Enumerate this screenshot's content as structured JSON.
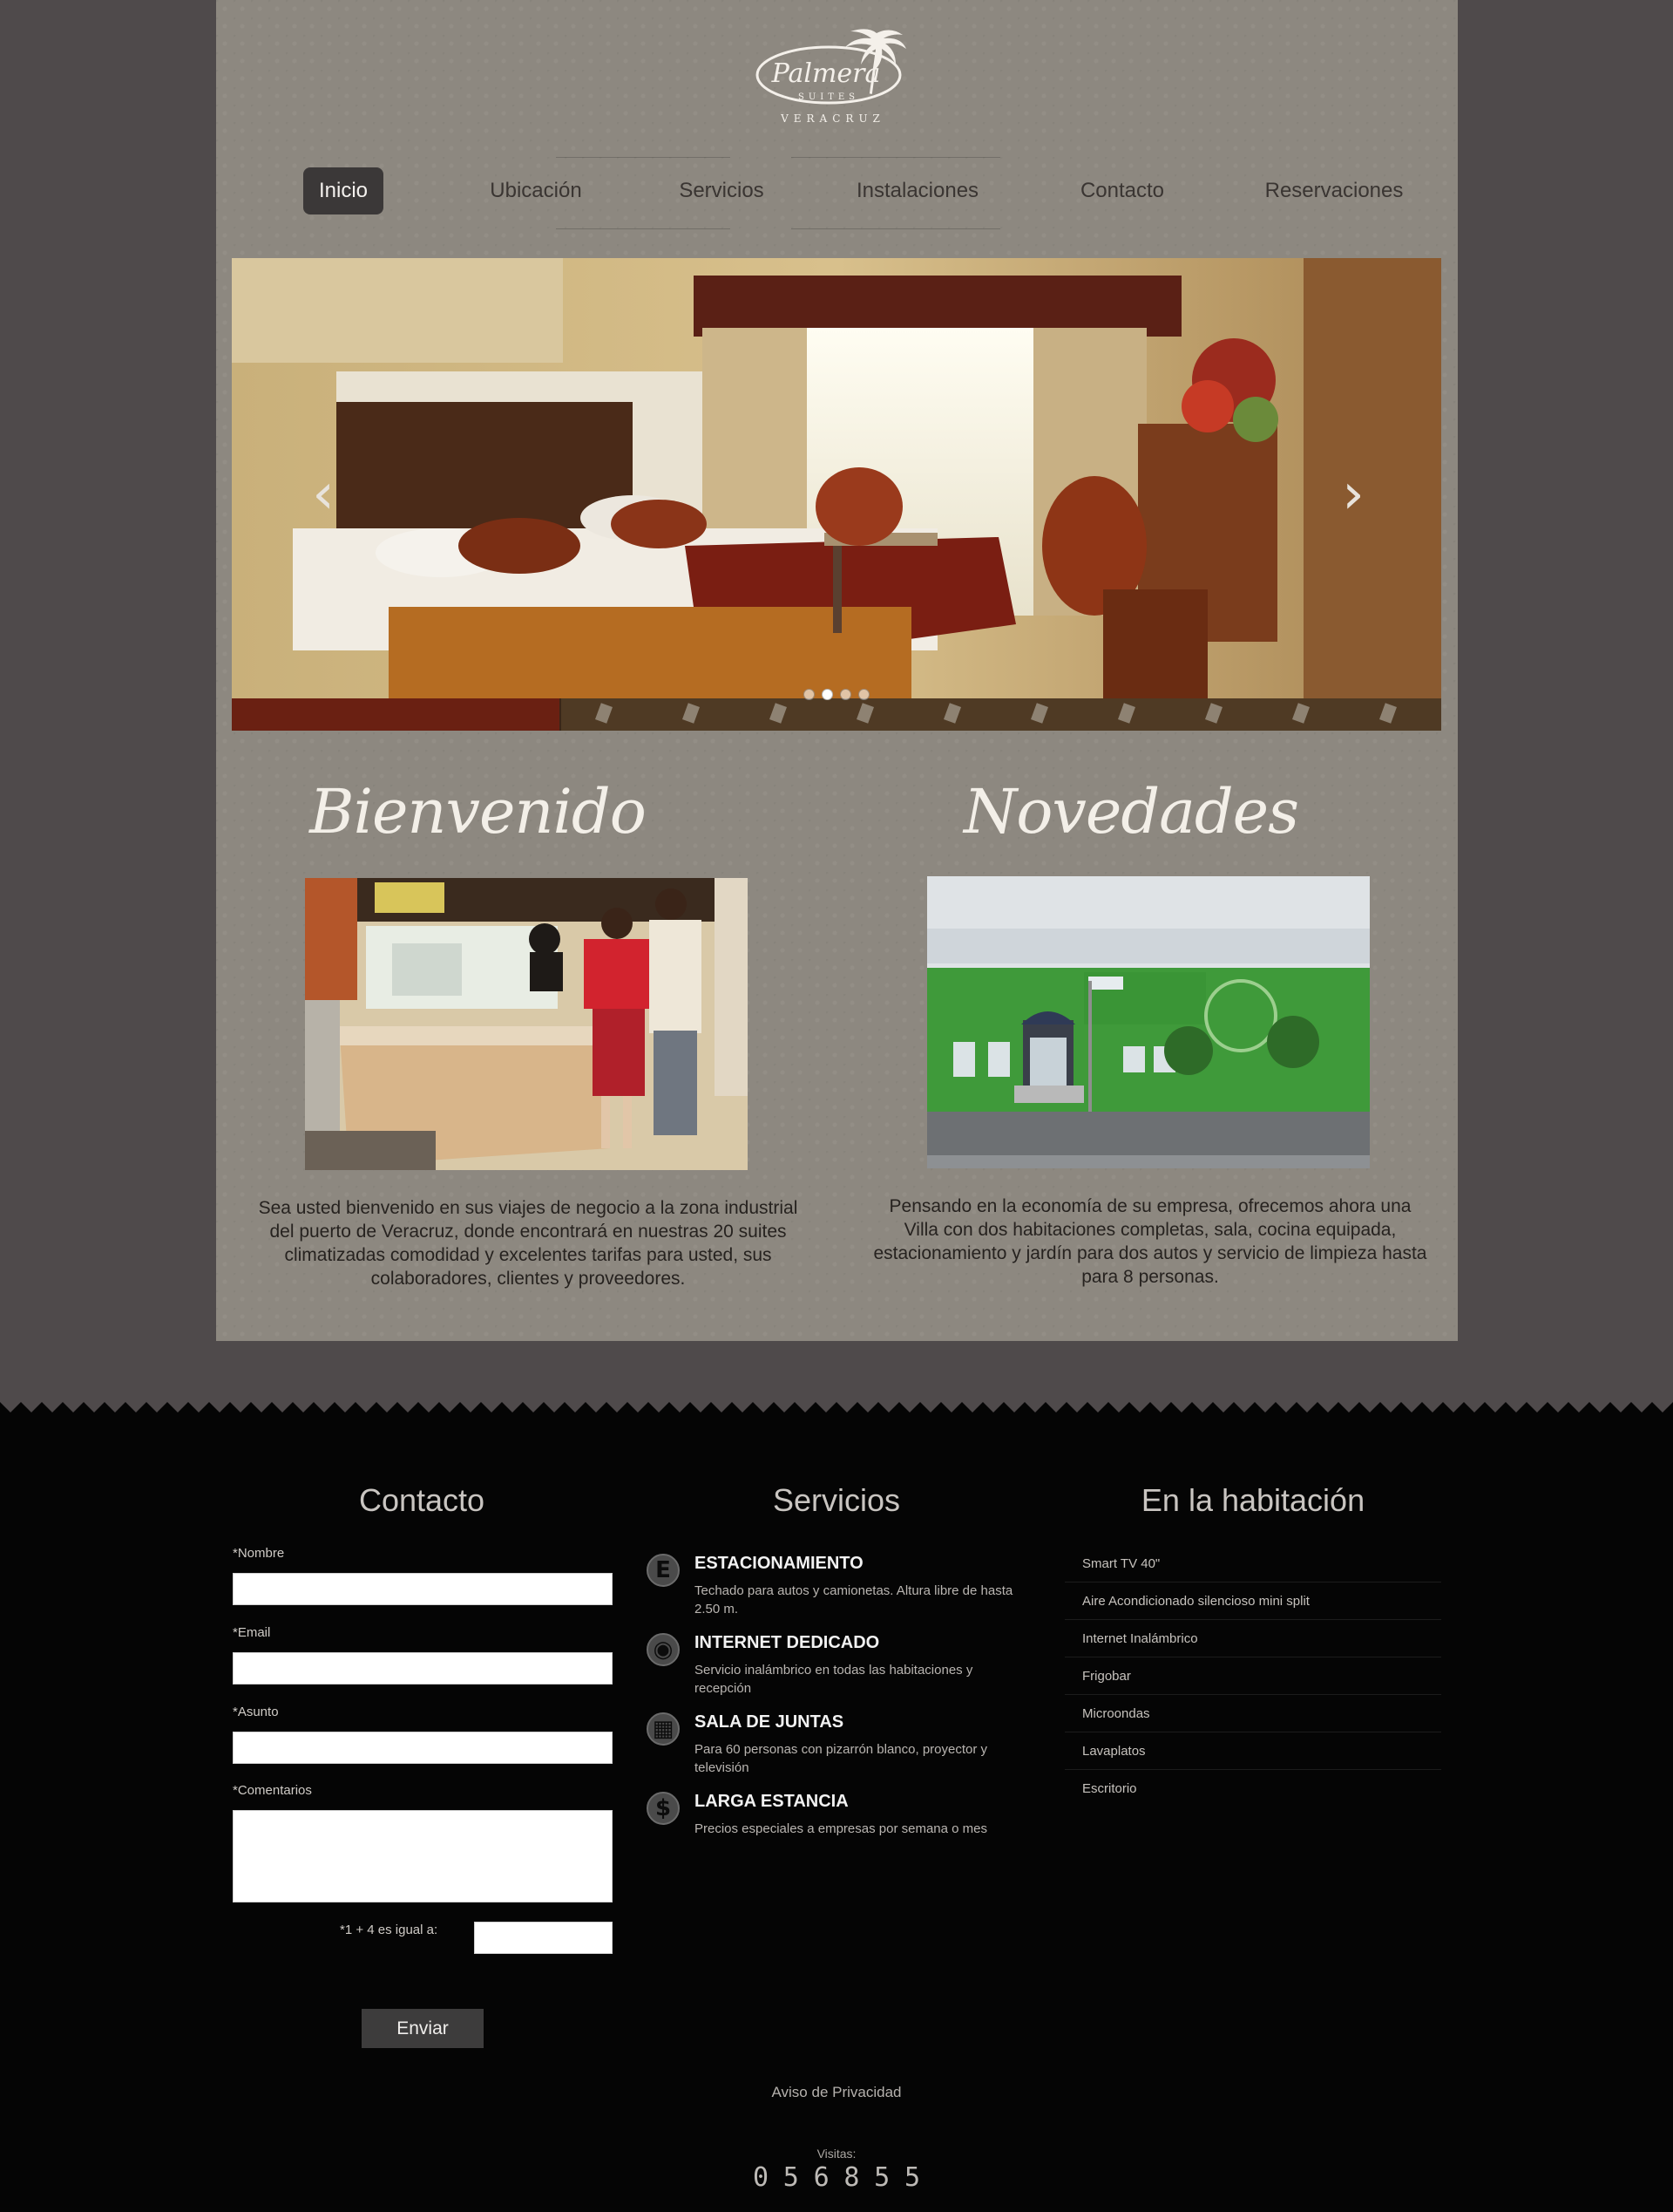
{
  "logo": {
    "name": "Palmera",
    "sub": "SUITES",
    "city": "VERACRUZ"
  },
  "nav": {
    "items": [
      {
        "label": "Inicio",
        "active": true
      },
      {
        "label": "Ubicación",
        "active": false
      },
      {
        "label": "Servicios",
        "active": false
      },
      {
        "label": "Instalaciones",
        "active": false
      },
      {
        "label": "Contacto",
        "active": false
      },
      {
        "label": "Reservaciones",
        "active": false
      }
    ]
  },
  "slider": {
    "prev": "‹",
    "next": "›",
    "slide_count": 4,
    "active_slide": 2
  },
  "welcome": {
    "title": "Bienvenido",
    "text": "Sea usted bienvenido en sus viajes de negocio a la zona industrial del puerto de Veracruz, donde encontrará en nuestras 20 suites climatizadas comodidad y excelentes tarifas para usted, sus colaboradores, clientes y proveedores."
  },
  "news": {
    "title": "Novedades",
    "text": "Pensando en la economía de su empresa, ofrecemos ahora una Villa con dos habitaciones completas, sala, cocina equipada, estacionamiento y jardín para dos autos y servicio de limpieza hasta para 8 personas."
  },
  "contact": {
    "title": "Contacto",
    "name_label": "*Nombre",
    "email_label": "*Email",
    "subject_label": "*Asunto",
    "comments_label": "*Comentarios",
    "captcha_label": "*1 + 4 es igual a:",
    "submit": "Enviar"
  },
  "services": {
    "title": "Servicios",
    "items": [
      {
        "icon": "E",
        "title": "ESTACIONAMIENTO",
        "desc": "Techado para autos y camionetas. Altura libre de hasta 2.50 m."
      },
      {
        "icon": "◉",
        "title": "INTERNET DEDICADO",
        "desc": "Servicio inalámbrico en todas las habitaciones y recepción"
      },
      {
        "icon": "▦",
        "title": "SALA DE JUNTAS",
        "desc": "Para 60 personas con pizarrón blanco, proyector y televisión"
      },
      {
        "icon": "$",
        "title": "LARGA ESTANCIA",
        "desc": "Precios especiales a empresas por semana o mes"
      }
    ]
  },
  "room": {
    "title": "En la habitación",
    "items": [
      "Smart TV 40\"",
      "Aire Acondicionado silencioso mini split",
      "Internet Inalámbrico",
      "Frigobar",
      "Microondas",
      "Lavaplatos",
      "Escritorio"
    ]
  },
  "footer": {
    "privacy": "Aviso de Privacidad",
    "visits_label": "Visitas:",
    "visits_digits": [
      "0",
      "5",
      "6",
      "8",
      "5",
      "5"
    ]
  },
  "colors": {
    "page_bg": "#8d8880",
    "outer_bg": "#4f4a4b",
    "footer_bg": "#050505",
    "nav_active": "#3b3838"
  }
}
